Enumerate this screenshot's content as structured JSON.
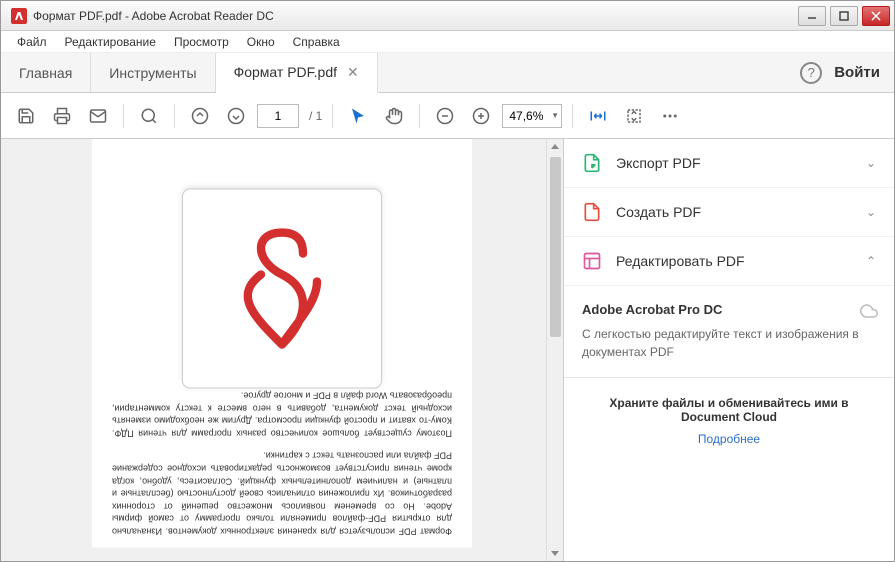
{
  "window": {
    "title": "Формат PDF.pdf - Adobe Acrobat Reader DC"
  },
  "menu": {
    "file": "Файл",
    "edit": "Редактирование",
    "view": "Просмотр",
    "window": "Окно",
    "help": "Справка"
  },
  "tabs": {
    "home": "Главная",
    "tools": "Инструменты",
    "doc": "Формат PDF.pdf",
    "signin": "Войти"
  },
  "toolbar": {
    "page_current": "1",
    "page_total": "/ 1",
    "zoom": "47,6%"
  },
  "document": {
    "para1": "Формат PDF используется для хранения электронных документов. Изначально для открытия PDF-файлов применяли только программу от самой фирмы Adobe. Но со временем появилось множество решений от сторонних разработчиков. Их приложения отличались своей доступностью (бесплатные и платные) и наличием дополнительных функций. Согласитесь, удобно, когда кроме чтения присутствует возможность редактировать исходное содержание PDF файла или распознать текст с картинки.",
    "para2": "Поэтому существует большое количество разных программ для чтения ПДФ. Кому-то хватит и простой функции просмотра. Другим же необходимо изменять исходный текст документа, добавить в него вместе к тексту комментарии, преобразовать Word файл в PDF и многое другое."
  },
  "panel": {
    "export": "Экспорт PDF",
    "create": "Создать PDF",
    "edit": "Редактировать PDF",
    "pro_title": "Adobe Acrobat Pro DC",
    "pro_desc": "С легкостью редактируйте текст и изображения в документах PDF",
    "footer_text": "Храните файлы и обменивайтесь ими в Document Cloud",
    "footer_link": "Подробнее"
  }
}
